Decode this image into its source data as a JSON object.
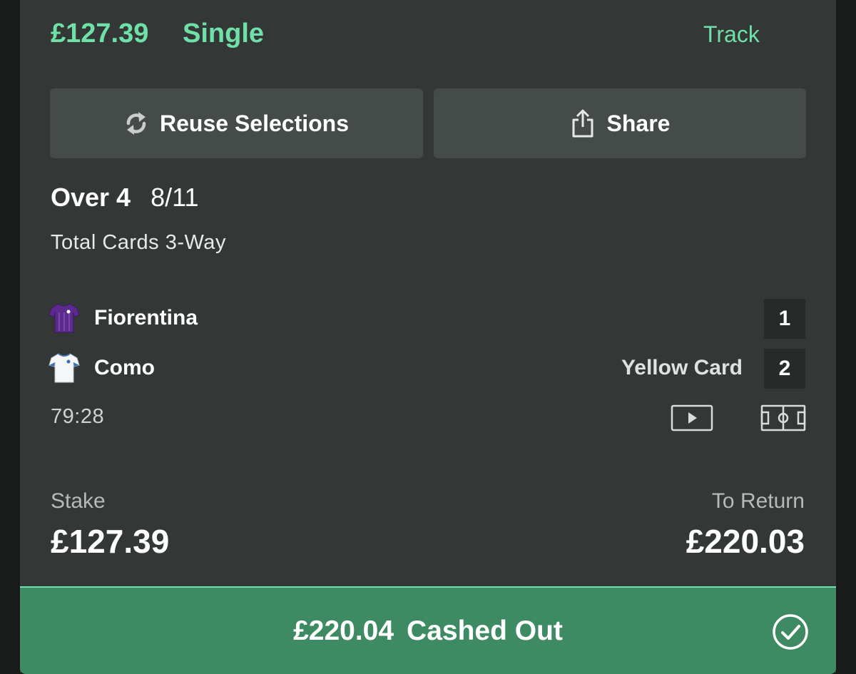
{
  "header": {
    "stake": "£127.39",
    "bet_type": "Single",
    "track_label": "Track"
  },
  "actions": {
    "reuse_label": "Reuse Selections",
    "share_label": "Share",
    "reuse_icon": "refresh-icon",
    "share_icon": "share-icon"
  },
  "selection": {
    "name": "Over 4",
    "odds": "8/11",
    "market": "Total Cards 3-Way"
  },
  "match": {
    "home_team": "Fiorentina",
    "home_score": "1",
    "away_team": "Como",
    "away_score": "2",
    "last_event": "Yellow Card",
    "clock": "79:28",
    "icons": [
      "video-icon",
      "pitch-icon"
    ]
  },
  "summary": {
    "stake_label": "Stake",
    "stake_value": "£127.39",
    "return_label": "To Return",
    "return_value": "£220.03"
  },
  "cashout": {
    "amount": "£220.04",
    "status": "Cashed Out",
    "icon": "check-circle-icon"
  },
  "colors": {
    "accent_green": "#6fe0a7",
    "cashout_bg": "#3e8a63",
    "card_bg": "#333836",
    "button_bg": "#454b49"
  }
}
